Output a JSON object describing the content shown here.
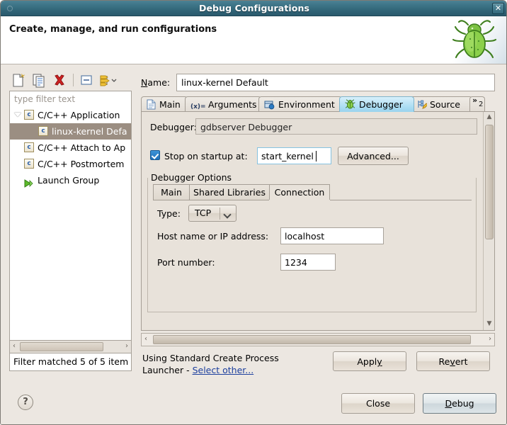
{
  "window": {
    "title": "Debug Configurations",
    "close_label": "✕"
  },
  "header": {
    "title": "Create, manage, and run configurations",
    "icon": "green-bug-icon"
  },
  "toolbar": {
    "buttons": [
      {
        "name": "new-configuration",
        "icon": "new-document-icon"
      },
      {
        "name": "duplicate-configuration",
        "icon": "copy-document-icon"
      },
      {
        "name": "delete-configuration",
        "icon": "red-x-icon"
      },
      {
        "name": "collapse-all",
        "icon": "collapse-all-icon"
      },
      {
        "name": "filter-menu",
        "icon": "filter-arrows-icon"
      },
      {
        "name": "filter-menu-dropdown",
        "icon": "chevron-down-icon"
      }
    ]
  },
  "filter": {
    "placeholder": "type filter text",
    "value": "",
    "status": "Filter matched 5 of 5 item"
  },
  "tree": {
    "items": [
      {
        "label": "C/C++ Application",
        "icon": "c-file-icon",
        "indent": 22,
        "twisty": true,
        "selected": false
      },
      {
        "label": "linux-kernel Defa",
        "icon": "c-file-icon",
        "indent": 42,
        "twisty": false,
        "selected": true
      },
      {
        "label": "C/C++ Attach to Ap",
        "icon": "c-file-icon",
        "indent": 22,
        "twisty": false,
        "selected": false
      },
      {
        "label": "C/C++ Postmortem",
        "icon": "c-file-icon",
        "indent": 22,
        "twisty": false,
        "selected": false
      },
      {
        "label": "Launch Group",
        "icon": "green-play-icon",
        "indent": 22,
        "twisty": false,
        "selected": false
      }
    ]
  },
  "name_field": {
    "label_pre": "N",
    "label_mnemonic": "N",
    "label": "Name:",
    "value": "linux-kernel Default"
  },
  "tabs": {
    "items": [
      {
        "label": "Main",
        "icon": "document-icon",
        "active": false
      },
      {
        "label": "Arguments",
        "icon": "arguments-icon",
        "active": false
      },
      {
        "label": "Environment",
        "icon": "environment-icon",
        "active": false
      },
      {
        "label": "Debugger",
        "icon": "bug-icon",
        "active": true
      },
      {
        "label": "Source",
        "icon": "source-lookup-icon",
        "active": false
      }
    ],
    "overflow_label": "»",
    "overflow_count": "2"
  },
  "debugger_tab": {
    "debugger_label": "Debugger:",
    "debugger_value": "gdbserver Debugger",
    "stop_on_startup_label": "Stop on startup at:",
    "stop_on_startup_checked": true,
    "stop_on_startup_value": "start_kernel",
    "advanced_label": "Advanced...",
    "options_group_label": "Debugger Options",
    "inner_tabs": [
      {
        "label": "Main",
        "active": false
      },
      {
        "label": "Shared Libraries",
        "active": false
      },
      {
        "label": "Connection",
        "active": true
      }
    ],
    "connection": {
      "type_label": "Type:",
      "type_value": "TCP",
      "host_label": "Host name or IP address:",
      "host_value": "localhost",
      "port_label": "Port number:",
      "port_value": "1234"
    }
  },
  "launcher": {
    "text_line1": "Using Standard Create Process",
    "text_line2_pre": "Launcher - ",
    "link_label": "Select other..."
  },
  "actions": {
    "apply": "Apply",
    "apply_mnemonic": "y",
    "revert": "Revert",
    "revert_mnemonic": "v",
    "close": "Close",
    "debug": "Debug",
    "debug_mnemonic": "D",
    "help": "?"
  },
  "colors": {
    "titlebar": "#2f6275",
    "dialog_bg": "#ece7e1",
    "active_tab": "#a9dcf2",
    "selection": "#9b8e82",
    "link": "#1c3f9e",
    "accent_bug": "#5aa832"
  }
}
